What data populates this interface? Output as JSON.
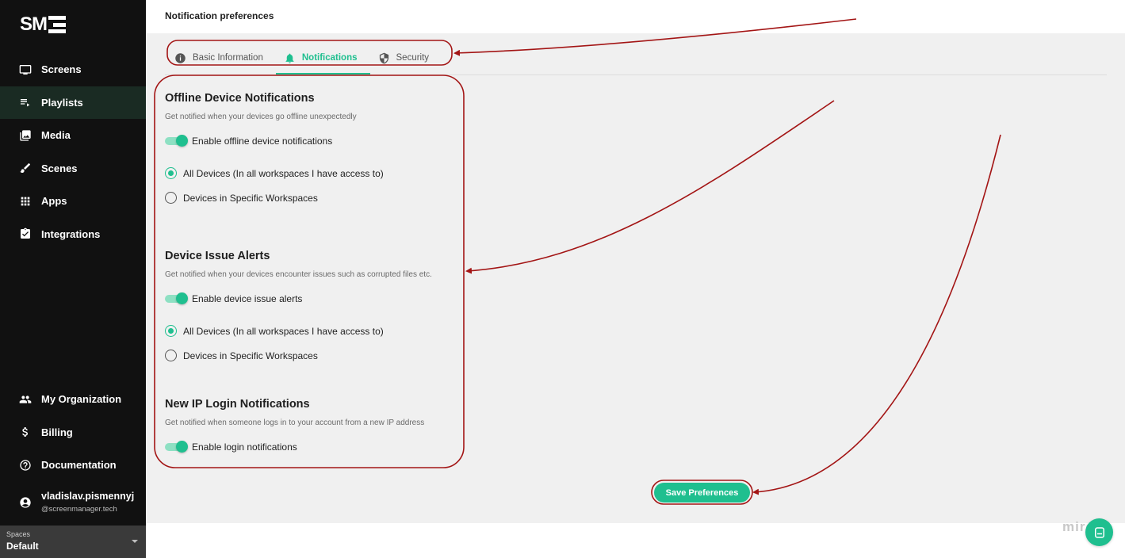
{
  "app": {
    "logo_text": "SM"
  },
  "sidebar": {
    "items": [
      {
        "label": "Screens",
        "icon": "monitor-icon"
      },
      {
        "label": "Playlists",
        "icon": "playlist-icon",
        "active": true
      },
      {
        "label": "Media",
        "icon": "media-icon"
      },
      {
        "label": "Scenes",
        "icon": "brush-icon"
      },
      {
        "label": "Apps",
        "icon": "apps-grid-icon"
      },
      {
        "label": "Integrations",
        "icon": "integrations-icon"
      }
    ],
    "bottom_items": [
      {
        "label": "My Organization",
        "icon": "people-icon"
      },
      {
        "label": "Billing",
        "icon": "dollar-icon"
      },
      {
        "label": "Documentation",
        "icon": "help-icon"
      }
    ],
    "user": {
      "name": "vladislav.pismennyj",
      "domain": "@screenmanager.tech",
      "icon": "account-icon"
    },
    "spaces": {
      "label": "Spaces",
      "value": "Default"
    }
  },
  "header": {
    "title": "Notification preferences"
  },
  "tabs": [
    {
      "label": "Basic Information",
      "icon": "info-icon"
    },
    {
      "label": "Notifications",
      "icon": "bell-icon",
      "active": true
    },
    {
      "label": "Security",
      "icon": "shield-icon"
    }
  ],
  "sections": {
    "offline": {
      "title": "Offline Device Notifications",
      "description": "Get notified when your devices go offline unexpectedly",
      "toggle_label": "Enable offline device notifications",
      "toggle_on": true,
      "options": [
        "All Devices (In all workspaces I have access to)",
        "Devices in Specific Workspaces"
      ],
      "selected": 0
    },
    "issues": {
      "title": "Device Issue Alerts",
      "description": "Get notified when your devices encounter issues such as corrupted files etc.",
      "toggle_label": "Enable device issue alerts",
      "toggle_on": true,
      "options": [
        "All Devices (In all workspaces I have access to)",
        "Devices in Specific Workspaces"
      ],
      "selected": 0
    },
    "login": {
      "title": "New IP Login Notifications",
      "description": "Get notified when someone logs in to your account from a new IP address",
      "toggle_label": "Enable login notifications",
      "toggle_on": true
    }
  },
  "actions": {
    "save_label": "Save Preferences"
  },
  "watermark": "miro",
  "colors": {
    "accent": "#1fbf8f",
    "sidebar_bg": "#111111",
    "annotation": "#a31515"
  }
}
